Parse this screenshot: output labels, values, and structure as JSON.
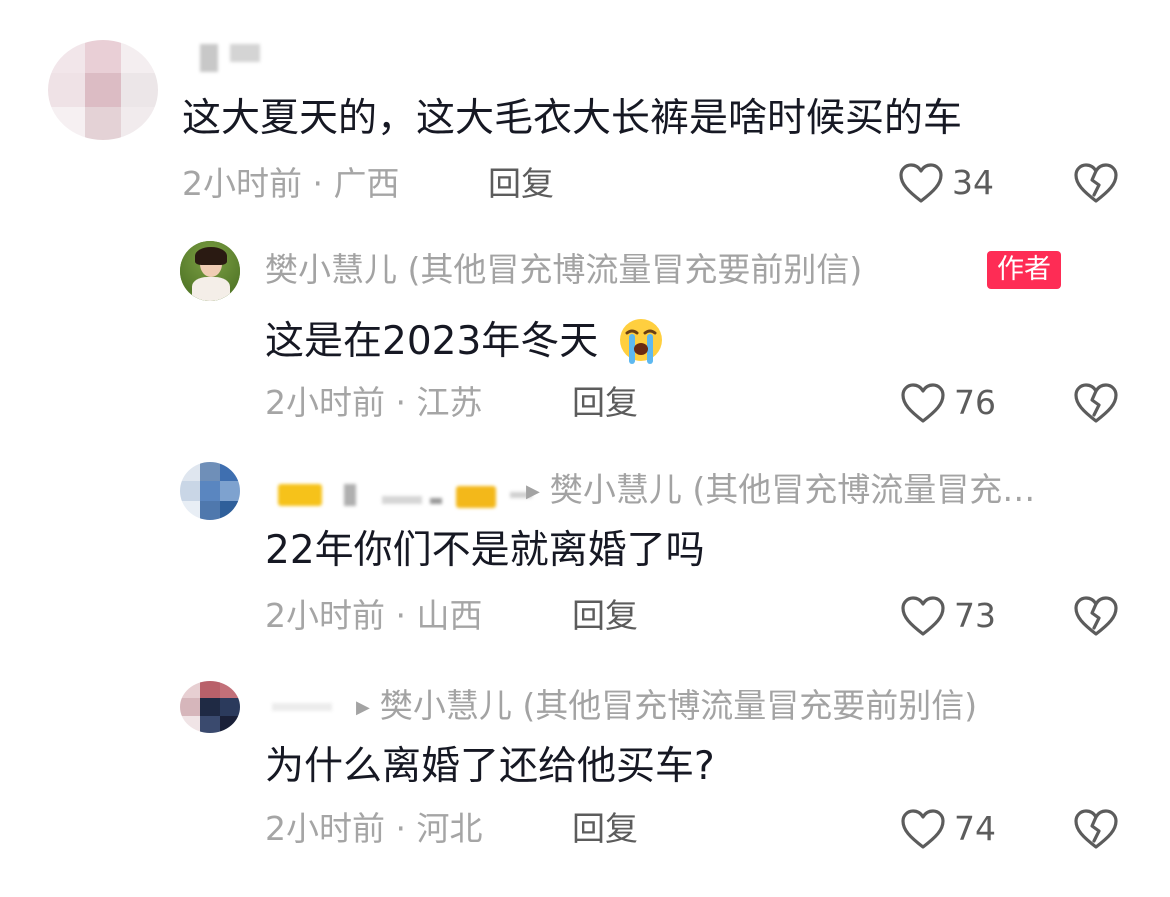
{
  "comments": [
    {
      "text": "这大夏天的，这大毛衣大长裤是啥时候买的车",
      "time": "2小时前",
      "location": "广西",
      "reply_label": "回复",
      "likes": "34"
    },
    {
      "author": "樊小慧儿 (其他冒充博流量冒充要前别信)",
      "badge": "作者",
      "text": "这是在2023年冬天",
      "emoji": "crying-face-icon",
      "time": "2小时前",
      "location": "江苏",
      "reply_label": "回复",
      "likes": "76"
    },
    {
      "reply_to": "樊小慧儿 (其他冒充博流量冒充…",
      "text": "22年你们不是就离婚了吗",
      "time": "2小时前",
      "location": "山西",
      "reply_label": "回复",
      "likes": "73"
    },
    {
      "reply_to": "樊小慧儿 (其他冒充博流量冒充要前别信)",
      "text": "为什么离婚了还给他买车?",
      "time": "2小时前",
      "location": "河北",
      "reply_label": "回复",
      "likes": "74"
    }
  ],
  "meta_separator": "·",
  "colors": {
    "text": "#161823",
    "secondary": "#a5a5a5",
    "action": "#5c5c5c",
    "badge": "#fe2c55"
  }
}
